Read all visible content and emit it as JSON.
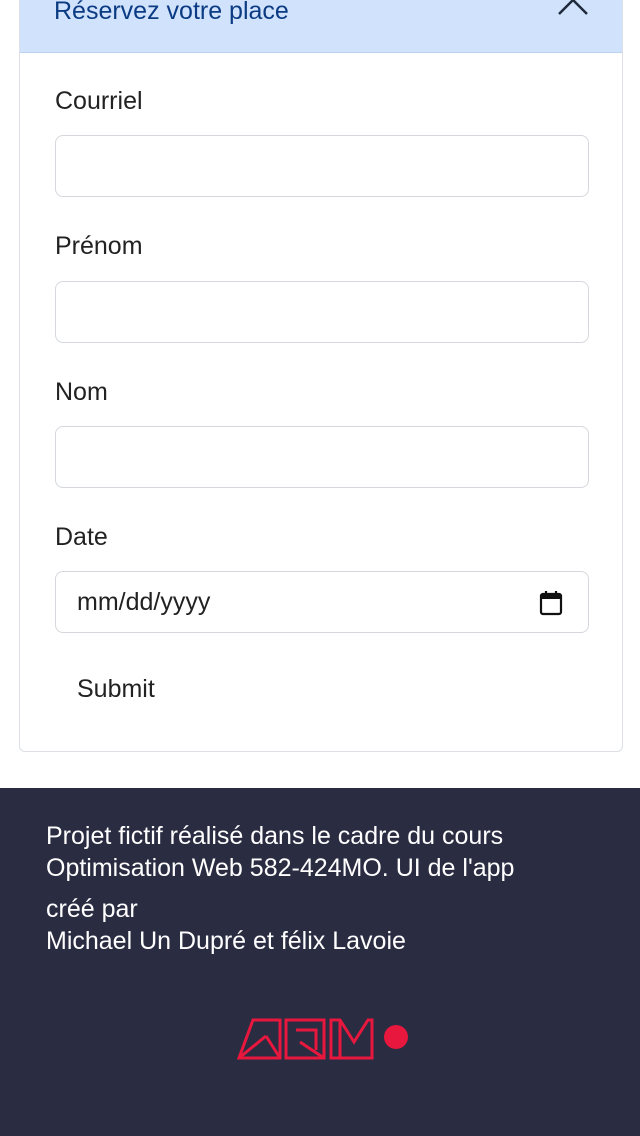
{
  "accordion": {
    "title": "Réservez votre place",
    "state": "expanded"
  },
  "form": {
    "email": {
      "label": "Courriel",
      "value": "",
      "placeholder": ""
    },
    "first_name": {
      "label": "Prénom",
      "value": "",
      "placeholder": ""
    },
    "last_name": {
      "label": "Nom",
      "value": "",
      "placeholder": ""
    },
    "date": {
      "label": "Date",
      "placeholder": "mm/dd/yyyy",
      "icon": "calendar-icon"
    },
    "submit_label": "Submit"
  },
  "footer": {
    "line1": "Projet fictif réalisé dans le cadre du cours",
    "line2": "Optimisation Web 582-424MO. UI de l'app",
    "line3": "créé par",
    "line4": "Michael Un Dupré et félix Lavoie",
    "logo_text": "AQM",
    "logo_color": "#e8173d"
  },
  "colors": {
    "accordion_bg": "#d0e2fc",
    "accordion_text": "#0b3b82",
    "footer_bg": "#2a2c42",
    "logo": "#e8173d"
  }
}
